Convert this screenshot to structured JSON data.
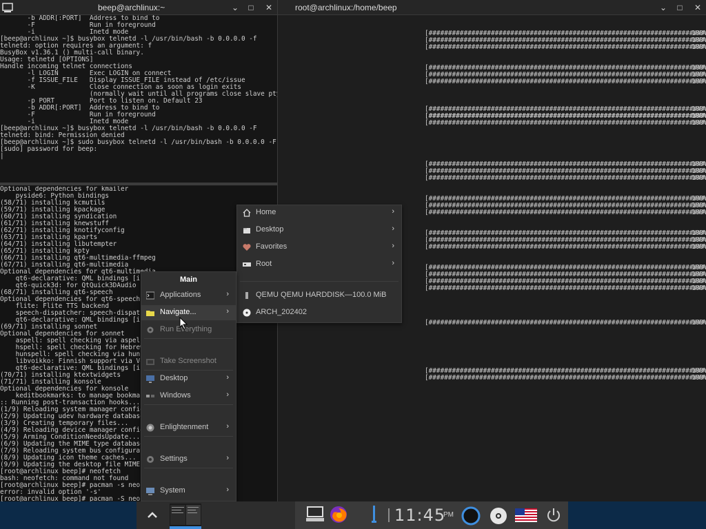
{
  "windows": {
    "left": {
      "title": "beep@archlinux:~",
      "controls": [
        "chevron-down-icon",
        "maximize-icon",
        "close-icon"
      ]
    },
    "right": {
      "title": "root@archlinux:/home/beep",
      "controls": [
        "chevron-down-icon",
        "maximize-icon",
        "close-icon"
      ]
    }
  },
  "terminal_top": {
    "lines": [
      "       -b ADDR[:PORT]  Address to bind to",
      "       -F              Run in foreground",
      "       -i              Inetd mode",
      "[beep@archlinux ~]$ busybox telnetd -l /usr/bin/bash -b 0.0.0.0 -f",
      "telnetd: option requires an argument: f",
      "BusyBox v1.36.1 () multi-call binary.",
      "",
      "Usage: telnetd [OPTIONS]",
      "",
      "Handle incoming telnet connections",
      "",
      "       -l LOGIN        Exec LOGIN on connect",
      "       -f ISSUE_FILE   Display ISSUE_FILE instead of /etc/issue",
      "       -K              Close connection as soon as login exits",
      "                       (normally wait until all programs close slave pty)",
      "       -p PORT         Port to listen on. Default 23",
      "       -b ADDR[:PORT]  Address to bind to",
      "       -F              Run in foreground",
      "       -i              Inetd mode",
      "[beep@archlinux ~]$ busybox telnetd -l /usr/bin/bash -b 0.0.0.0 -F",
      "telnetd: bind: Permission denied",
      "[beep@archlinux ~]$ sudo busybox telnetd -l /usr/bin/bash -b 0.0.0.0 -F",
      "[sudo] password for beep:",
      "|"
    ]
  },
  "terminal_bottom": {
    "lines": [
      "Optional dependencies for kmailer",
      "    pyside6: Python bindings",
      "(58/71) installing kcmutils",
      "(59/71) installing kpackage",
      "(60/71) installing syndication",
      "(61/71) installing knewstuff",
      "(62/71) installing knotifyconfig",
      "(63/71) installing kparts",
      "(64/71) installing libutempter",
      "(65/71) installing kpty",
      "(66/71) installing qt6-multimedia-ffmpeg",
      "(67/71) installing qt6-multimedia",
      "Optional dependencies for qt6-multimedia",
      "    qt6-declarative: QML bindings [installed]",
      "    qt6-quick3d: for QtQuick3DAudio",
      "(68/71) installing qt6-speech",
      "Optional dependencies for qt6-speech",
      "    flite: Flite TTS backend",
      "    speech-dispatcher: speech-dispatcher",
      "    qt6-declarative: QML bindings [installed]",
      "(69/71) installing sonnet",
      "Optional dependencies for sonnet",
      "    aspell: spell checking via aspell",
      "    hspell: spell checking for Hebrew",
      "    hunspell: spell checking via hunspell",
      "    libvoikko: Finnish support via Voikko",
      "    qt6-declarative: QML bindings [installed]",
      "(70/71) installing ktextwidgets",
      "(71/71) installing konsole",
      "Optional dependencies for konsole",
      "    keditbookmarks: to manage bookmarks",
      ":: Running post-transaction hooks...",
      "(1/9) Reloading system manager configuration...",
      "(2/9) Updating udev hardware database...",
      "(3/9) Creating temporary files...",
      "(4/9) Reloading device manager configuration...",
      "(5/9) Arming ConditionNeedsUpdate...",
      "(6/9) Updating the MIME type database...",
      "(7/9) Reloading system bus configuration...",
      "(8/9) Updating icon theme caches...",
      "(9/9) Updating the desktop file MIME type cache...",
      "[root@archlinux beep]# neofetch",
      "bash: neofetch: command not found",
      "[root@archlinux beep]# pacman -s neofetch",
      "error: invalid option '-s'",
      "[root@archlinux beep]# pacman -S neofetch"
    ]
  },
  "terminal_right": {
    "progress_bar_text": "[##############################################################################]",
    "percent_text": "100%",
    "groups": [
      3,
      3,
      3,
      1,
      3,
      3,
      3,
      3,
      1,
      1,
      2
    ]
  },
  "menu_main": {
    "title": "Main",
    "items": [
      {
        "label": "Applications",
        "icon": "terminal-icon",
        "submenu": true,
        "state": "normal"
      },
      {
        "label": "Navigate...",
        "icon": "folder-icon",
        "submenu": true,
        "state": "active"
      },
      {
        "label": "Run Everything",
        "icon": "gear-icon",
        "submenu": false,
        "state": "disabled"
      },
      {
        "label": "Take Screenshot",
        "icon": "screenshot-icon",
        "submenu": false,
        "state": "disabled"
      },
      {
        "label": "Desktop",
        "icon": "desktop-icon",
        "submenu": true,
        "state": "normal"
      },
      {
        "label": "Windows",
        "icon": "windows-icon",
        "submenu": true,
        "state": "normal"
      },
      {
        "label": "Enlightenment",
        "icon": "enlightenment-icon",
        "submenu": true,
        "state": "normal"
      },
      {
        "label": "Settings",
        "icon": "settings-icon",
        "submenu": true,
        "state": "normal"
      },
      {
        "label": "System",
        "icon": "system-icon",
        "submenu": true,
        "state": "normal"
      }
    ]
  },
  "menu_navigate": {
    "items": [
      {
        "label": "Home",
        "icon": "home-icon",
        "submenu": true
      },
      {
        "label": "Desktop",
        "icon": "desktop-folder-icon",
        "submenu": true
      },
      {
        "label": "Favorites",
        "icon": "heart-icon",
        "submenu": true
      },
      {
        "label": "Root",
        "icon": "drive-icon",
        "submenu": true
      },
      {
        "label": "QEMU QEMU HARDDISK—100.0 MiB",
        "icon": "harddisk-icon",
        "submenu": false
      },
      {
        "label": "ARCH_202402",
        "icon": "optical-disc-icon",
        "submenu": false
      }
    ]
  },
  "shelf": {
    "clock": "11:45",
    "ampm": "PM",
    "items": [
      "start-button",
      "pager",
      "terminal-launcher",
      "firefox-launcher",
      "volume-indicator",
      "clock",
      "enlightenment-status",
      "optical-disc-indicator",
      "us-flag-keyboard-layout",
      "power-button"
    ]
  },
  "colors": {
    "shelf_accent": "#3f8fe0",
    "shelf_background": "#0c2a48",
    "menu_background": "#2f2f2f"
  }
}
